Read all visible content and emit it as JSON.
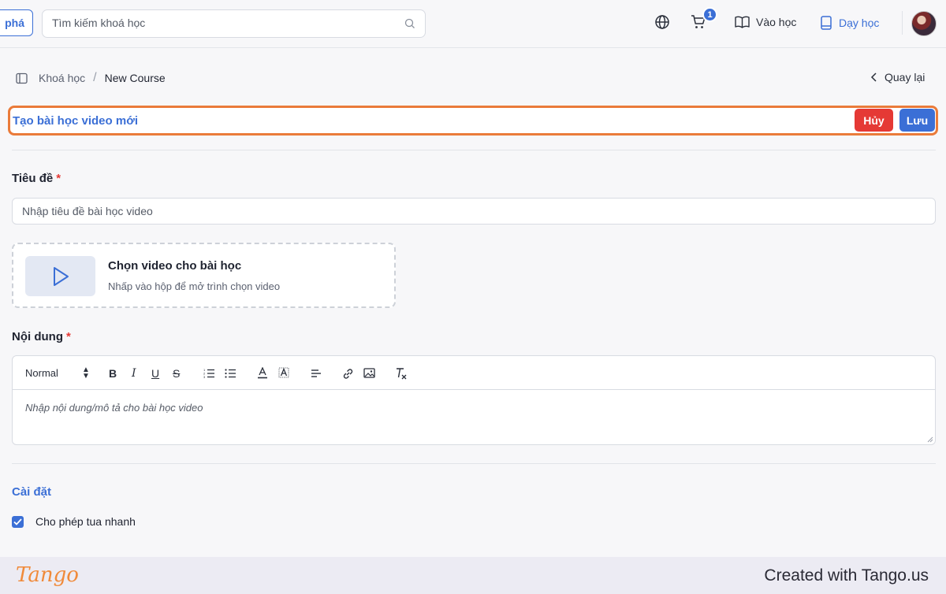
{
  "topbar": {
    "explore_label": "phá",
    "search_placeholder": "Tìm kiếm khoá học",
    "cart_count": "1",
    "learn_label": "Vào học",
    "teach_label": "Dạy học"
  },
  "breadcrumb": {
    "item1": "Khoá học",
    "separator": "/",
    "item2": "New Course"
  },
  "back_label": "Quay lại",
  "form": {
    "heading": "Tạo bài học video mới",
    "cancel_label": "Hủy",
    "save_label": "Lưu",
    "title_label": "Tiêu đề",
    "required_mark": "*",
    "title_placeholder": "Nhập tiêu đề bài học video",
    "video_title": "Chọn video cho bài học",
    "video_subtitle": "Nhấp vào hộp để mở trình chọn video",
    "content_label": "Nội dung",
    "editor": {
      "format_value": "Normal",
      "placeholder": "Nhập nội dung/mô tả cho bài học video",
      "bold": "B",
      "italic": "I",
      "underline": "U",
      "strike": "S"
    },
    "settings_title": "Cài đặt",
    "fast_forward_label": "Cho phép tua nhanh",
    "fast_forward_checked": true
  },
  "footer": {
    "logo": "Tango",
    "credit": "Created with Tango.us"
  },
  "colors": {
    "accent": "#3b6fd6",
    "danger": "#e53935",
    "highlight": "#ea7b3a"
  }
}
